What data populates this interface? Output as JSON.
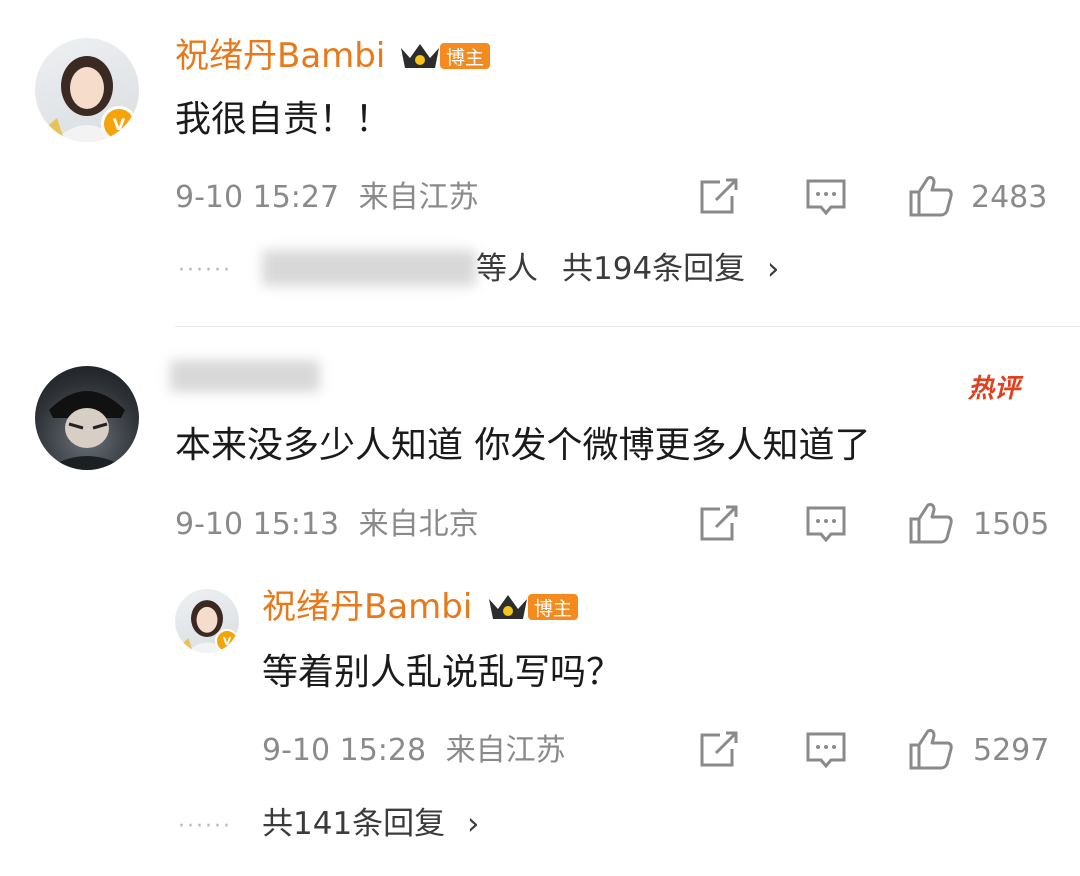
{
  "comments": [
    {
      "username": "祝绪丹Bambi",
      "badge": "博主",
      "text": "我很自责！！",
      "time": "9-10 15:27",
      "location": "来自江苏",
      "likes": "2483",
      "likers_suffix": "等人",
      "replies": "共194条回复",
      "verified_mark": "V"
    },
    {
      "hot_tag": "热评",
      "text": "本来没多少人知道 你发个微博更多人知道了",
      "time": "9-10 15:13",
      "location": "来自北京",
      "likes": "1505",
      "reply": {
        "username": "祝绪丹Bambi",
        "badge": "博主",
        "text": "等着别人乱说乱写吗？",
        "time": "9-10 15:28",
        "location": "来自江苏",
        "likes": "5297",
        "verified_mark": "V"
      },
      "replies": "共141条回复"
    }
  ],
  "icons": {
    "share": "share-icon",
    "comment": "comment-icon",
    "like": "thumbs-up-icon",
    "crown": "crown-icon",
    "chevron": "chevron-right-icon"
  },
  "colors": {
    "username": "#e8791a",
    "badge": "#f58a1f",
    "hot": "#e0401f",
    "meta": "#8a8a8a"
  }
}
